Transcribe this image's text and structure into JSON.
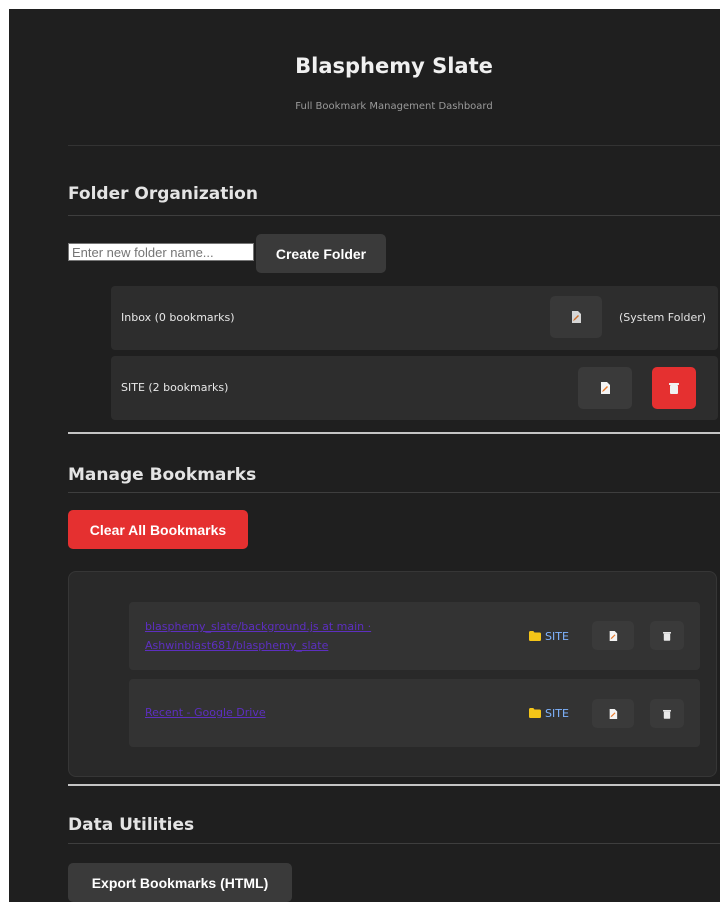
{
  "header": {
    "title": "Blasphemy Slate",
    "subtitle": "Full Bookmark Management Dashboard"
  },
  "folders_section": {
    "title": "Folder Organization",
    "input_placeholder": "Enter new folder name...",
    "create_label": "Create Folder",
    "folders": [
      {
        "label": "Inbox (0 bookmarks)",
        "note": "(System Folder)",
        "edit_icon": "edit-icon"
      },
      {
        "label": "SITE (2 bookmarks)",
        "edit_icon": "edit-icon",
        "delete_icon": "trash-icon"
      }
    ]
  },
  "bookmarks_section": {
    "title": "Manage Bookmarks",
    "clear_label": "Clear All Bookmarks",
    "bookmarks": [
      {
        "line1": "blasphemy_slate/background.js at main ·",
        "line2": "Ashwinblast681/blasphemy_slate",
        "folder": "SITE"
      },
      {
        "line1": "Recent - Google Drive",
        "folder": "SITE"
      }
    ]
  },
  "utilities_section": {
    "title": "Data Utilities",
    "export_label": "Export Bookmarks (HTML)"
  },
  "colors": {
    "background": "#1f1f1f",
    "panel": "#2d2d2d",
    "danger": "#e53030",
    "link": "#5d2fc0",
    "folder_tag": "#7fb4ff",
    "folder_icon": "#f5c518"
  }
}
